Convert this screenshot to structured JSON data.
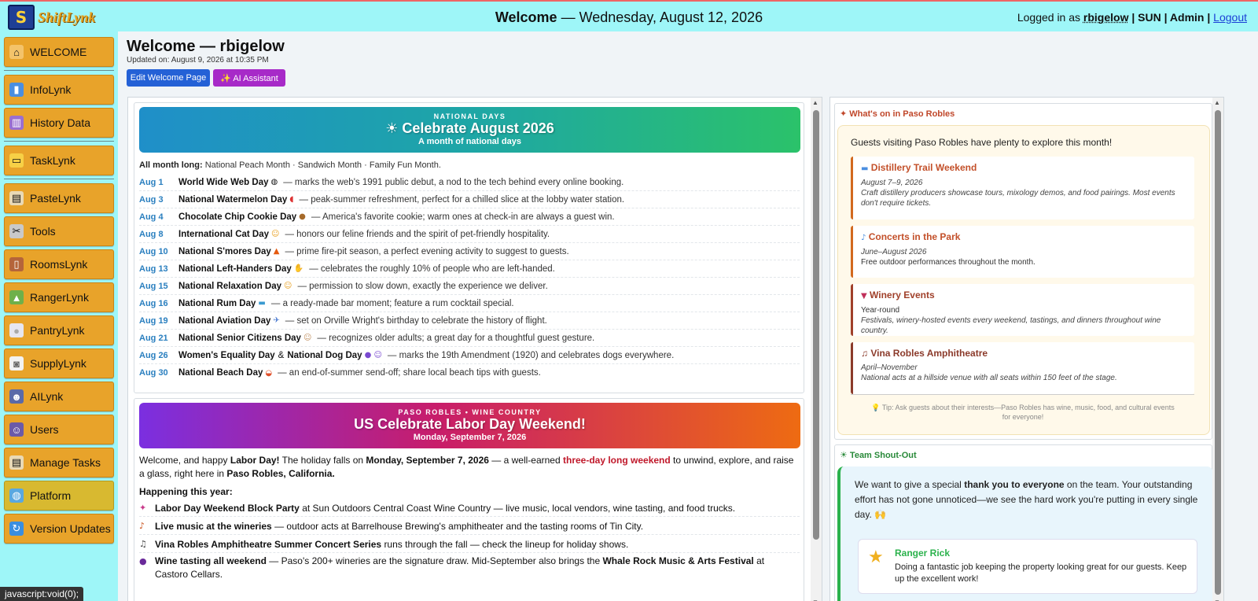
{
  "topbar": {
    "logo_mark": "S",
    "logo_text": "ShiftLynk",
    "welcome": "Welcome",
    "date": "— Wednesday, August 12, 2026",
    "logged_prefix": "Logged in as",
    "username": "rbigelow",
    "role_info": "| SUN | Admin |",
    "logout": "Logout"
  },
  "sidebar": {
    "items": [
      {
        "label": "WELCOME",
        "icon": "house-icon",
        "glyph": "⌂"
      },
      {
        "label": "InfoLynk",
        "icon": "book-icon",
        "glyph": "▮"
      },
      {
        "label": "History Data",
        "icon": "books-icon",
        "glyph": "▥"
      },
      {
        "label": "TaskLynk",
        "icon": "folder-icon",
        "glyph": "▭"
      },
      {
        "label": "PasteLynk",
        "icon": "clipboard-icon",
        "glyph": "▤"
      },
      {
        "label": "Tools",
        "icon": "tools-icon",
        "glyph": "✂"
      },
      {
        "label": "RoomsLynk",
        "icon": "door-icon",
        "glyph": "▯"
      },
      {
        "label": "RangerLynk",
        "icon": "ranger-icon",
        "glyph": "▲"
      },
      {
        "label": "PantryLynk",
        "icon": "plate-icon",
        "glyph": "●"
      },
      {
        "label": "SupplyLynk",
        "icon": "paper-roll-icon",
        "glyph": "◙"
      },
      {
        "label": "AILynk",
        "icon": "robot-icon",
        "glyph": "☻"
      },
      {
        "label": "Users",
        "icon": "users-icon",
        "glyph": "☺"
      },
      {
        "label": "Manage Tasks",
        "icon": "clipboard-icon",
        "glyph": "▤"
      },
      {
        "label": "Platform",
        "icon": "globe-icon",
        "glyph": "◍"
      },
      {
        "label": "Version Updates",
        "icon": "refresh-icon",
        "glyph": "↻"
      }
    ]
  },
  "status_bar": "javascript:void(0);",
  "main": {
    "title": "Welcome — rbigelow",
    "updated": "Updated on: August 9, 2026 at 10:35 PM",
    "edit_button": "Edit Welcome Page",
    "ai_button": "✨ AI Assistant"
  },
  "national_days": {
    "kicker": "NATIONAL DAYS",
    "title": "☀ Celebrate August 2026",
    "subtitle": "A month of national days",
    "all_month_label": "All month long:",
    "all_month_text": "National Peach Month · Sandwich Month · Family Fun Month.",
    "days": [
      {
        "date": "Aug 1",
        "name": "World Wide Web Day",
        "emoji": "◍",
        "text": "— marks the web's 1991 public debut, a nod to the tech behind every online booking."
      },
      {
        "date": "Aug 3",
        "name": "National Watermelon Day",
        "emoji": "◖",
        "text": "— peak-summer refreshment, perfect for a chilled slice at the lobby water station."
      },
      {
        "date": "Aug 4",
        "name": "Chocolate Chip Cookie Day",
        "emoji": "●",
        "text": "— America's favorite cookie; warm ones at check-in are always a guest win."
      },
      {
        "date": "Aug 8",
        "name": "International Cat Day",
        "emoji": "☺",
        "text": "— honors our feline friends and the spirit of pet-friendly hospitality."
      },
      {
        "date": "Aug 10",
        "name": "National S'mores Day",
        "emoji": "▲",
        "text": "— prime fire-pit season, a perfect evening activity to suggest to guests."
      },
      {
        "date": "Aug 13",
        "name": "National Left-Handers Day",
        "emoji": "✋",
        "text": "— celebrates the roughly 10% of people who are left-handed."
      },
      {
        "date": "Aug 15",
        "name": "National Relaxation Day",
        "emoji": "☺",
        "text": "— permission to slow down, exactly the experience we deliver."
      },
      {
        "date": "Aug 16",
        "name": "National Rum Day",
        "emoji": "▬",
        "text": "— a ready-made bar moment; feature a rum cocktail special."
      },
      {
        "date": "Aug 19",
        "name": "National Aviation Day",
        "emoji": "✈",
        "text": "— set on Orville Wright's birthday to celebrate the history of flight."
      },
      {
        "date": "Aug 21",
        "name": "National Senior Citizens Day",
        "emoji": "☺",
        "text": "— recognizes older adults; a great day for a thoughtful guest gesture."
      },
      {
        "date": "Aug 26",
        "name": "Women's Equality Day",
        "joiner": "&",
        "name2": "National Dog Day",
        "emoji": "● ☺",
        "text": "— marks the 19th Amendment (1920) and celebrates dogs everywhere."
      },
      {
        "date": "Aug 30",
        "name": "National Beach Day",
        "emoji": "◒",
        "text": "— an end-of-summer send-off; share local beach tips with guests."
      }
    ]
  },
  "labor_day": {
    "kicker": "PASO ROBLES • WINE COUNTRY",
    "title": "US Celebrate Labor Day Weekend!",
    "subtitle": "Monday, September 7, 2026",
    "intro_a": "Welcome, and happy",
    "intro_b": "Labor Day!",
    "intro_c": "The holiday falls on",
    "intro_d": "Monday, September 7, 2026",
    "intro_e": "— a well-earned",
    "intro_f": "three-day long weekend",
    "intro_g": "to unwind, explore, and raise a glass, right here in",
    "intro_h": "Paso Robles, California.",
    "happening": "Happening this year:",
    "items": [
      {
        "icon": "✦",
        "bold": "Labor Day Weekend Block Party",
        "text": "at Sun Outdoors Central Coast Wine Country — live music, local vendors, wine tasting, and food trucks."
      },
      {
        "icon": "♪",
        "bold": "Live music at the wineries",
        "text": "— outdoor acts at Barrelhouse Brewing's amphitheater and the tasting rooms of Tin City."
      },
      {
        "icon": "♫",
        "bold": "Vina Robles Amphitheatre Summer Concert Series",
        "text": "runs through the fall — check the lineup for holiday shows."
      },
      {
        "icon": "●",
        "bold": "Wine tasting all weekend",
        "text": "— Paso's 200+ wineries are the signature draw. Mid-September also brings the",
        "bold2": "Whale Rock Music & Arts Festival",
        "text2": "at Castoro Cellars."
      }
    ]
  },
  "paso": {
    "header": "✦ What's on in Paso Robles",
    "intro": "Guests visiting Paso Robles have plenty to explore this month!",
    "events": [
      {
        "title": "Distillery Trail Weekend",
        "date": "August 7–9, 2026",
        "desc": "Craft distillery producers showcase tours, mixology demos, and food pairings. Most events don't require tickets.",
        "color": "#d2691e"
      },
      {
        "title": "Concerts in the Park",
        "date": "June–August 2026",
        "desc": "Free outdoor performances throughout the month.",
        "color": "#d2691e"
      },
      {
        "title": "Winery Events",
        "date": "Year-round",
        "desc": "Festivals, winery-hosted events every weekend, tastings, and dinners throughout wine country.",
        "color": "#a0402a"
      },
      {
        "title": "♫ Vina Robles Amphitheatre",
        "date": "April–November",
        "desc": "National acts at a hillside venue with all seats within 150 feet of the stage.",
        "color": "#8b3a2a"
      }
    ],
    "tip": "💡 Tip: Ask guests about their interests—Paso Robles has wine, music, food, and cultural events for everyone!"
  },
  "shoutout": {
    "header": "☀ Team Shout-Out",
    "body_a": "We want to give a special",
    "body_b": "thank you to everyone",
    "body_c": "on the team. Your outstanding effort has not gone unnoticed—we see the hard work you're putting in every single day. 🙌",
    "person_name": "Ranger Rick",
    "person_text": "Doing a fantastic job keeping the property looking great for our guests. Keep up the excellent work!"
  }
}
